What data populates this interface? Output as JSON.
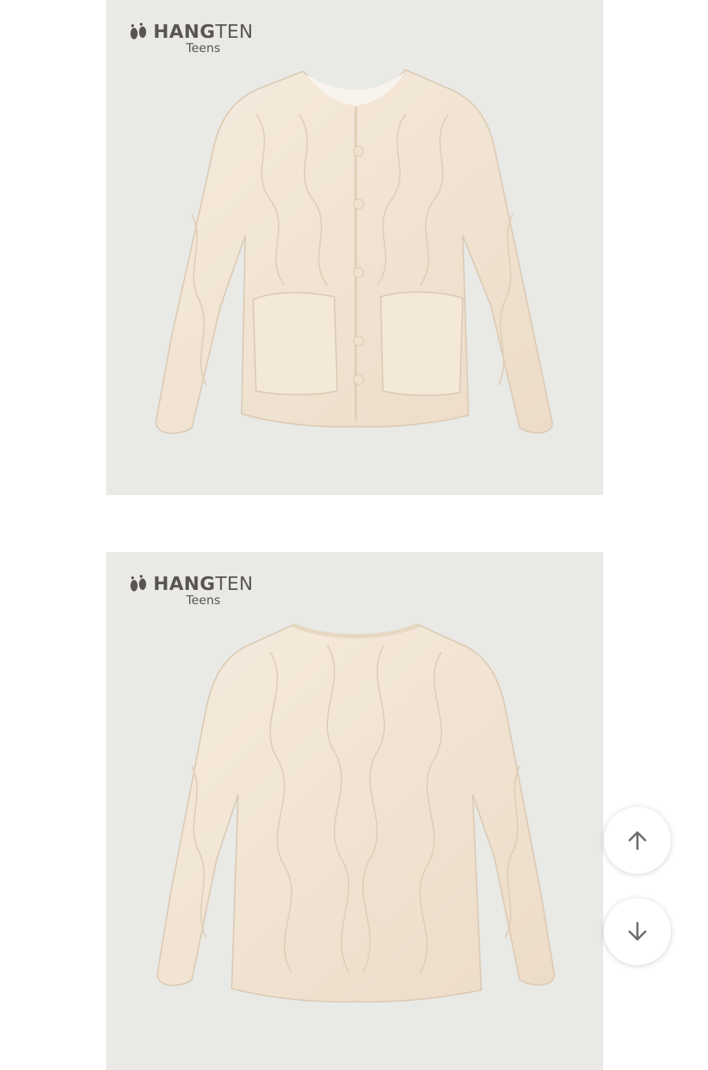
{
  "images": [
    {
      "label": "front",
      "logo_main": "HANG",
      "logo_main2": "TEN",
      "logo_sub": "Teens"
    },
    {
      "label": "back",
      "logo_main": "HANG",
      "logo_main2": "TEN",
      "logo_sub": "Teens"
    }
  ],
  "controls": {
    "scroll_up_icon": "arrow-up-icon",
    "scroll_down_icon": "arrow-down-icon"
  },
  "colors": {
    "image_background": "#e9e9e6",
    "jacket": "#f3e6d6",
    "logo": "#5a5552"
  }
}
